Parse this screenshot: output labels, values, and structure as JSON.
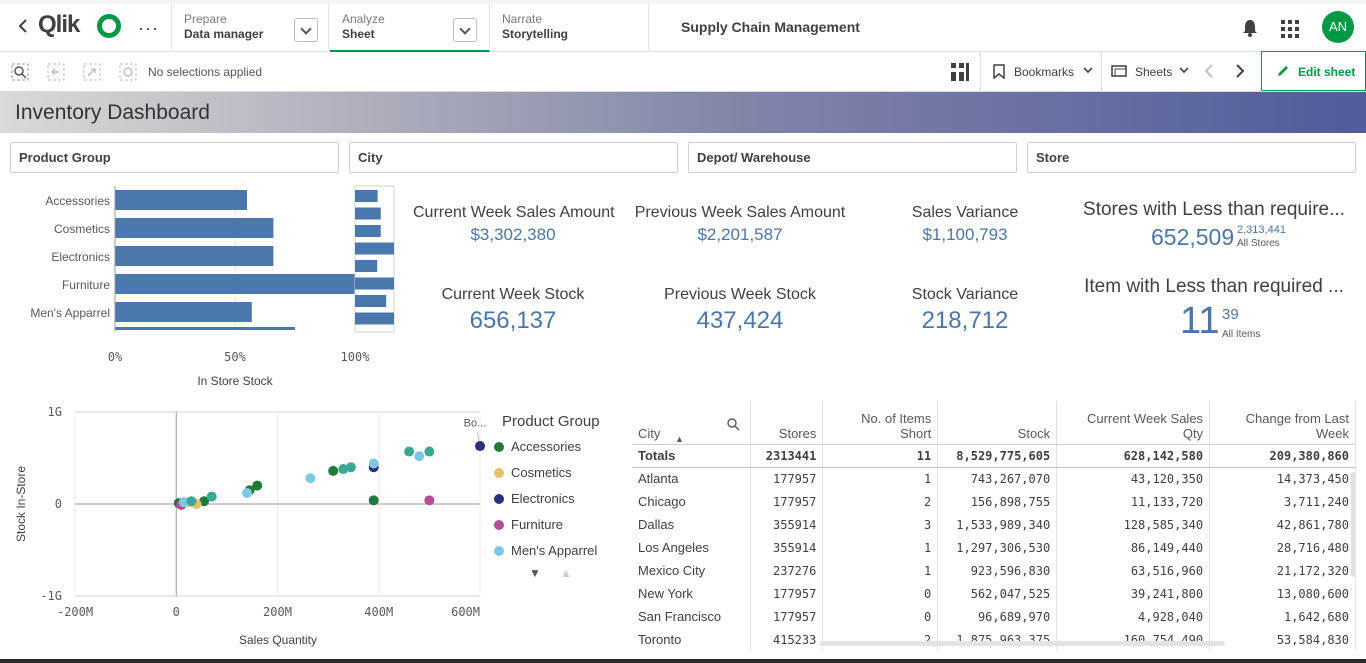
{
  "nav": {
    "prepare": {
      "label": "Prepare",
      "value": "Data manager"
    },
    "analyze": {
      "label": "Analyze",
      "value": "Sheet"
    },
    "narrate": {
      "label": "Narrate",
      "value": "Storytelling"
    },
    "app_title": "Supply Chain Management",
    "avatar": "AN",
    "logo": "Qlik"
  },
  "selections": {
    "status": "No selections applied",
    "bookmarks": "Bookmarks",
    "sheets": "Sheets",
    "edit": "Edit sheet"
  },
  "sheet_title": "Inventory Dashboard",
  "filters": [
    "Product Group",
    "City",
    "Depot/ Warehouse",
    "Store"
  ],
  "kpis": {
    "cw_sales_title": "Current Week Sales Amount",
    "cw_sales": "$3,302,380",
    "pw_sales_title": "Previous Week Sales Amount",
    "pw_sales": "$2,201,587",
    "sv_title": "Sales Variance",
    "sv": "$1,100,793",
    "cw_stock_title": "Current Week Stock",
    "cw_stock": "656,137",
    "pw_stock_title": "Previous Week Stock",
    "pw_stock": "437,424",
    "stv_title": "Stock Variance",
    "stv": "218,712",
    "stores_title": "Stores with Less than require...",
    "stores": "652,509",
    "stores_sub": "2,313,441",
    "stores_sub_lbl": "All Stores",
    "items_title": "Item with Less than required ...",
    "items": "11",
    "items_sub": "39",
    "items_sub_lbl": "All Items"
  },
  "chart_data": [
    {
      "type": "bar",
      "orientation": "horizontal",
      "categories": [
        "Accessories",
        "Cosmetics",
        "Electronics",
        "Furniture",
        "Men's Apparrel"
      ],
      "values": [
        55,
        66,
        66,
        100,
        57
      ],
      "xlabel": "In Store Stock",
      "x_ticks": [
        "0%",
        "50%",
        "100%"
      ],
      "xlim": [
        0,
        100
      ],
      "color": "#4a78ad"
    },
    {
      "type": "scatter",
      "xlabel": "Sales Quantity",
      "ylabel": "Stock In-Store",
      "x_ticks": [
        "-200M",
        "0",
        "200M",
        "400M",
        "600M"
      ],
      "y_ticks": [
        "1G",
        "0",
        "-1G"
      ],
      "xlim": [
        -200,
        600
      ],
      "ylim": [
        -1,
        1
      ],
      "annotation": "Bo...",
      "legend_title": "Product Group",
      "legend": "right",
      "series": [
        {
          "name": "Accessories",
          "color": "#1e7b3b",
          "points": [
            [
              5,
              0.01
            ],
            [
              55,
              0.03
            ],
            [
              145,
              0.15
            ],
            [
              160,
              0.2
            ],
            [
              310,
              0.36
            ],
            [
              390,
              0.04
            ]
          ]
        },
        {
          "name": "Cosmetics",
          "color": "#e2c36b",
          "points": [
            [
              25,
              0.02
            ],
            [
              40,
              0.0
            ]
          ]
        },
        {
          "name": "Electronics",
          "color": "#2b2f7c",
          "points": [
            [
              390,
              0.4
            ],
            [
              600,
              0.63
            ]
          ]
        },
        {
          "name": "Furniture",
          "color": "#b44d96",
          "points": [
            [
              10,
              -0.01
            ],
            [
              500,
              0.04
            ]
          ]
        },
        {
          "name": "Men's Apparrel",
          "color": "#7ec8e3",
          "points": [
            [
              15,
              0.02
            ],
            [
              140,
              0.12
            ],
            [
              265,
              0.28
            ],
            [
              390,
              0.44
            ],
            [
              480,
              0.52
            ]
          ]
        },
        {
          "name": "",
          "color": "#3aa894",
          "points": [
            [
              30,
              0.03
            ],
            [
              70,
              0.08
            ],
            [
              330,
              0.38
            ],
            [
              345,
              0.4
            ],
            [
              460,
              0.57
            ],
            [
              500,
              0.57
            ]
          ]
        }
      ]
    }
  ],
  "legend_more": "▼",
  "table": {
    "columns": [
      "City",
      "Stores",
      "No. of Items Short",
      "Stock",
      "Current Week Sales Qty",
      "Change from Last Week"
    ],
    "totals": [
      "Totals",
      "2313441",
      "11",
      "8,529,775,605",
      "628,142,580",
      "209,380,860"
    ],
    "rows": [
      [
        "Atlanta",
        "177957",
        "1",
        "743,267,070",
        "43,120,350",
        "14,373,450"
      ],
      [
        "Chicago",
        "177957",
        "2",
        "156,898,755",
        "11,133,720",
        "3,711,240"
      ],
      [
        "Dallas",
        "355914",
        "3",
        "1,533,989,340",
        "128,585,340",
        "42,861,780"
      ],
      [
        "Los Angeles",
        "355914",
        "1",
        "1,297,306,530",
        "86,149,440",
        "28,716,480"
      ],
      [
        "Mexico City",
        "237276",
        "1",
        "923,596,830",
        "63,516,960",
        "21,172,320"
      ],
      [
        "New York",
        "177957",
        "0",
        "562,047,525",
        "39,241,800",
        "13,080,600"
      ],
      [
        "San Francisco",
        "177957",
        "0",
        "96,689,970",
        "4,928,040",
        "1,642,680"
      ],
      [
        "Toronto",
        "415233",
        "2",
        "1,875,963,375",
        "160,754,490",
        "53,584,830"
      ]
    ]
  }
}
